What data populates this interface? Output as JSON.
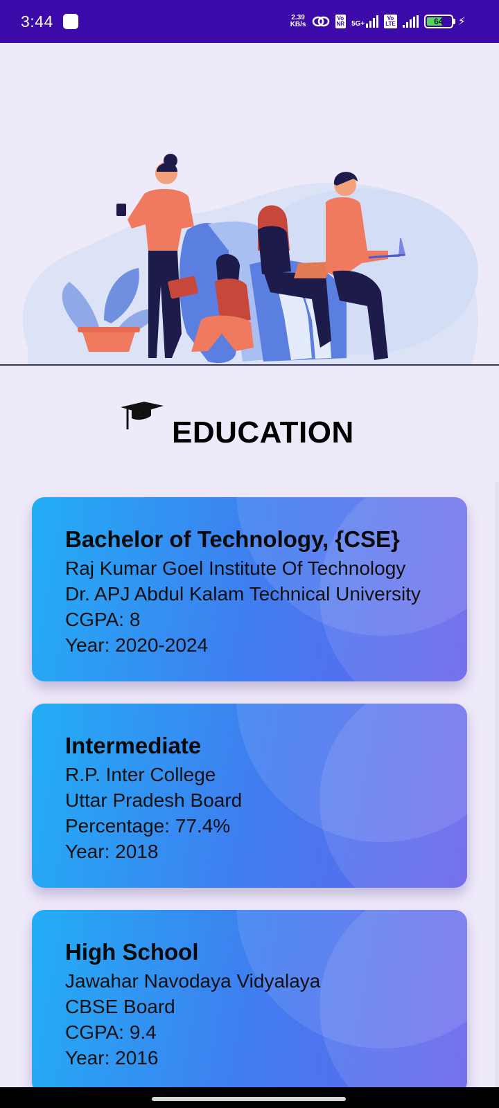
{
  "status_bar": {
    "time": "3:44",
    "net_speed_value": "2.39",
    "net_speed_unit": "KB/s",
    "volte_tag_top": "Vo",
    "volte_tag_bottom": "NR",
    "network_label": "5G+",
    "lte_tag_top": "Vo",
    "lte_tag_bottom": "LTE",
    "battery_level": "64",
    "icons": [
      "hotspot-icon",
      "signal-icon",
      "battery-icon",
      "charging-icon"
    ]
  },
  "hero": {
    "illustration": "students-studying-illustration"
  },
  "section": {
    "icon": "graduation-cap-icon",
    "title": "EDUCATION"
  },
  "education": [
    {
      "title": "Bachelor of Technology, {CSE}",
      "lines": [
        "Raj Kumar Goel Institute Of Technology",
        "Dr. APJ Abdul Kalam Technical University",
        "CGPA: 8",
        "Year: 2020-2024"
      ]
    },
    {
      "title": "Intermediate",
      "lines": [
        "R.P. Inter College",
        "Uttar Pradesh Board",
        "Percentage: 77.4%",
        "Year: 2018"
      ]
    },
    {
      "title": "High School",
      "lines": [
        "Jawahar Navodaya Vidyalaya",
        "CBSE Board",
        "CGPA: 9.4",
        "Year: 2016"
      ]
    }
  ],
  "colors": {
    "status_bar": "#3b0aa8",
    "background": "#efeafa",
    "card_gradient_start": "#22aef5",
    "card_gradient_end": "#6862ec"
  }
}
